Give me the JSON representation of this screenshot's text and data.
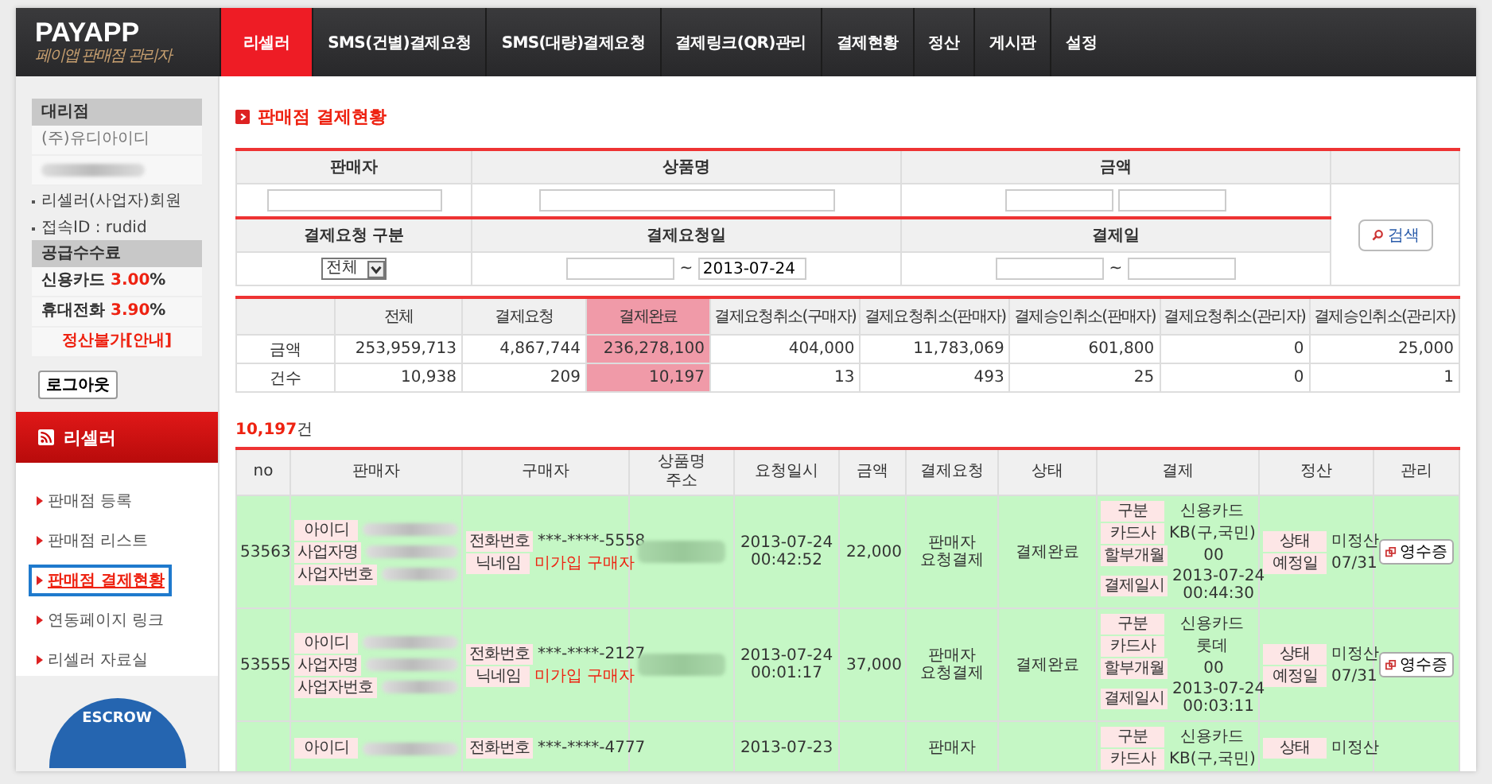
{
  "logo": {
    "title": "PAYAPP",
    "subtitle": "페이앱 판매점 관리자"
  },
  "nav": [
    {
      "label": "리셀러",
      "selected": true
    },
    {
      "label": "SMS(건별)결제요청",
      "selected": false
    },
    {
      "label": "SMS(대량)결제요청",
      "selected": false
    },
    {
      "label": "결제링크(QR)관리",
      "selected": false
    },
    {
      "label": "결제현황",
      "selected": false
    },
    {
      "label": "정산",
      "selected": false
    },
    {
      "label": "게시판",
      "selected": false
    },
    {
      "label": "설정",
      "selected": false
    }
  ],
  "sidebar": {
    "agency_heading": "대리점",
    "agency_name": "(주)유디아이디",
    "info": [
      "리셀러(사업자)회원",
      "접속ID : rudid"
    ],
    "fee_heading": "공급수수료",
    "fees": [
      "신용카드 **3.00**%",
      "휴대전화 **3.90**%"
    ],
    "notice_link": "정산불가[안내]",
    "logout": "로그아웃",
    "menu_title": "리셀러",
    "menu": [
      {
        "label": "판매점 등록",
        "selected": false
      },
      {
        "label": "판매점 리스트",
        "selected": false
      },
      {
        "label": "판매점 결제현황",
        "selected": true
      },
      {
        "label": "연동페이지 링크",
        "selected": false
      },
      {
        "label": "리셀러 자료실",
        "selected": false
      }
    ],
    "badge": "ESCROW"
  },
  "page_title": "판매점 결제현황",
  "search": {
    "headers_1": [
      "판매자",
      "상품명",
      "금액"
    ],
    "headers_2": [
      "결제요청 구분",
      "결제요청일",
      "결제일"
    ],
    "type_select": "전체",
    "range_separator": "~",
    "request_date_to": "2013-07-24",
    "button": "검색"
  },
  "summary": {
    "columns": [
      {
        "label": "전체",
        "highlighted": false
      },
      {
        "label": "결제요청",
        "highlighted": false
      },
      {
        "label": "결제완료",
        "highlighted": true
      },
      {
        "label": "결제요청취소(구매자)",
        "highlighted": false
      },
      {
        "label": "결제요청취소(판매자)",
        "highlighted": false
      },
      {
        "label": "결제승인취소(판매자)",
        "highlighted": false
      },
      {
        "label": "결제요청취소(관리자)",
        "highlighted": false
      },
      {
        "label": "결제승인취소(관리자)",
        "highlighted": false
      }
    ],
    "rows": [
      {
        "label": "금액",
        "values": [
          "253,959,713",
          "4,867,744",
          "236,278,100",
          "404,000",
          "11,783,069",
          "601,800",
          "0",
          "25,000"
        ]
      },
      {
        "label": "건수",
        "values": [
          "10,938",
          "209",
          "10,197",
          "13",
          "493",
          "25",
          "0",
          "1"
        ]
      }
    ]
  },
  "result_count": "**10,197**건",
  "list": {
    "columns": [
      "no",
      "판매자",
      "구매자",
      [
        "상품명",
        "주소"
      ],
      "요청일시",
      "금액",
      "결제요청",
      "상태",
      "결제",
      "정산",
      "관리"
    ],
    "rows": [
      {
        "no": "53563",
        "seller": [
          "아이디",
          "사업자명",
          "사업자번호"
        ],
        "buyer": [
          {
            "label": "전화번호",
            "value": "***-****-5558",
            "warn": false
          },
          {
            "label": "닉네임",
            "value": "미가입 구매자",
            "warn": true
          }
        ],
        "requested": [
          "2013-07-24",
          "00:42:52"
        ],
        "amount": "22,000",
        "request": [
          "판매자",
          "요청결제"
        ],
        "status": "결제완료",
        "payment": [
          {
            "label": "구분",
            "value": [
              "신용카드"
            ]
          },
          {
            "label": "카드사",
            "value": [
              "KB(구,국민)"
            ]
          },
          {
            "label": "할부개월",
            "value": [
              "00"
            ]
          },
          {
            "label": "결제일시",
            "value": [
              "2013-07-24",
              "00:44:30"
            ]
          }
        ],
        "settlement": [
          {
            "label": "상태",
            "value": "미정산"
          },
          {
            "label": "예정일",
            "value": "07/31"
          }
        ],
        "receipt": "영수증"
      },
      {
        "no": "53555",
        "seller": [
          "아이디",
          "사업자명",
          "사업자번호"
        ],
        "buyer": [
          {
            "label": "전화번호",
            "value": "***-****-2127",
            "warn": false
          },
          {
            "label": "닉네임",
            "value": "미가입 구매자",
            "warn": true
          }
        ],
        "requested": [
          "2013-07-24",
          "00:01:17"
        ],
        "amount": "37,000",
        "request": [
          "판매자",
          "요청결제"
        ],
        "status": "결제완료",
        "payment": [
          {
            "label": "구분",
            "value": [
              "신용카드"
            ]
          },
          {
            "label": "카드사",
            "value": [
              "롯데"
            ]
          },
          {
            "label": "할부개월",
            "value": [
              "00"
            ]
          },
          {
            "label": "결제일시",
            "value": [
              "2013-07-24",
              "00:03:11"
            ]
          }
        ],
        "settlement": [
          {
            "label": "상태",
            "value": "미정산"
          },
          {
            "label": "예정일",
            "value": "07/31"
          }
        ],
        "receipt": "영수증"
      },
      {
        "seller": [
          "아이디"
        ],
        "buyer": [
          {
            "label": "전화번호",
            "value": "***-****-4777",
            "warn": false
          }
        ],
        "requested": [
          "2013-07-23"
        ],
        "request": [
          "판매자"
        ],
        "payment": [
          {
            "label": "구분",
            "value": [
              "신용카드"
            ]
          },
          {
            "label": "카드사",
            "value": [
              "KB(구,국민)"
            ]
          }
        ],
        "settlement": [
          {
            "label": "상태",
            "value": "미정산"
          }
        ]
      }
    ]
  }
}
